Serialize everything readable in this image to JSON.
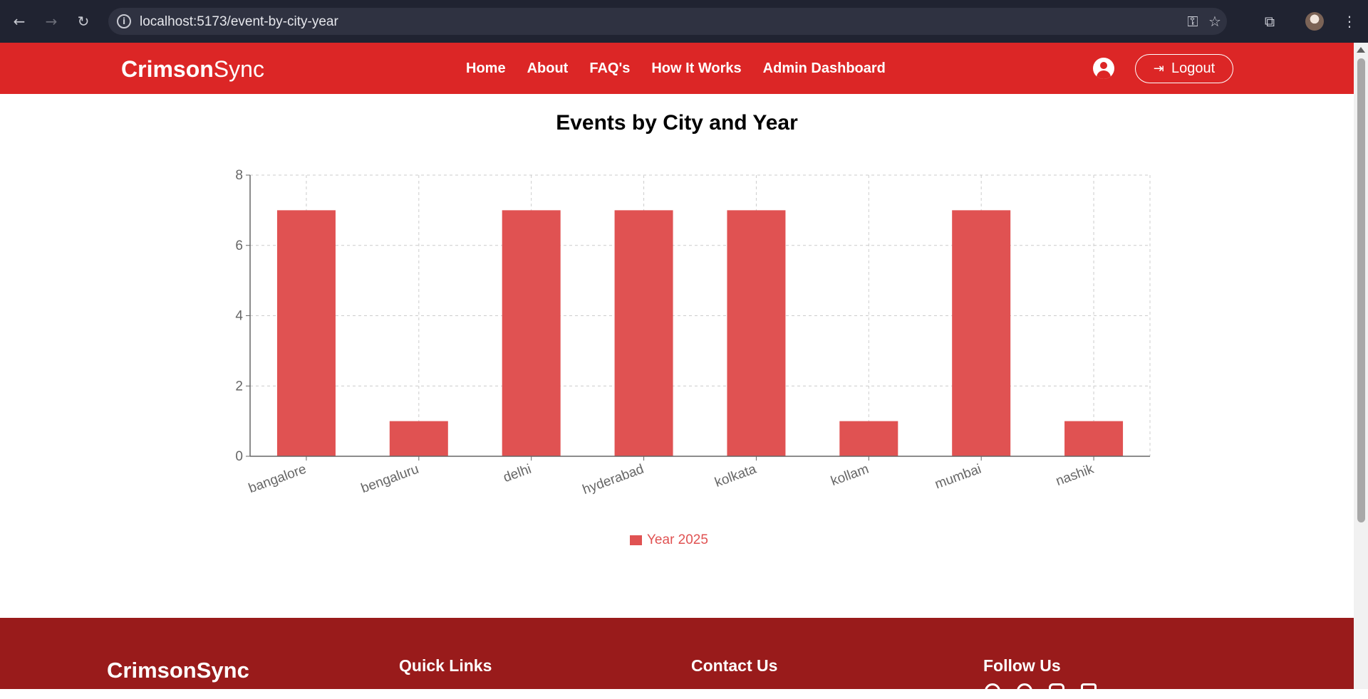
{
  "browser": {
    "url": "localhost:5173/event-by-city-year",
    "icons": [
      "back-arrow-icon",
      "forward-arrow-icon",
      "reload-icon",
      "site-info-icon",
      "password-key-icon",
      "bookmark-star-icon",
      "extensions-icon",
      "profile-avatar",
      "menu-kebab-icon"
    ]
  },
  "header": {
    "brand_bold": "Crimson",
    "brand_light": "Sync",
    "nav": [
      "Home",
      "About",
      "FAQ's",
      "How It Works",
      "Admin Dashboard"
    ],
    "logout_label": "Logout",
    "background": "#dc2626"
  },
  "main": {
    "title": "Events by City and Year"
  },
  "chart_data": {
    "type": "bar",
    "title": "Events by City and Year",
    "categories": [
      "bangalore",
      "bengaluru",
      "delhi",
      "hyderabad",
      "kolkata",
      "kollam",
      "mumbai",
      "nashik"
    ],
    "series": [
      {
        "name": "Year 2025",
        "values": [
          7,
          1,
          7,
          7,
          7,
          1,
          7,
          1
        ],
        "color": "#e05252"
      }
    ],
    "xlabel": "",
    "ylabel": "",
    "ylim": [
      0,
      8
    ],
    "yticks": [
      "0",
      "2",
      "4",
      "6",
      "8"
    ],
    "grid": true,
    "legend_position": "bottom"
  },
  "footer": {
    "brand": "CrimsonSync",
    "headings": [
      "Quick Links",
      "Contact Us",
      "Follow Us"
    ],
    "background": "#991b1b"
  }
}
